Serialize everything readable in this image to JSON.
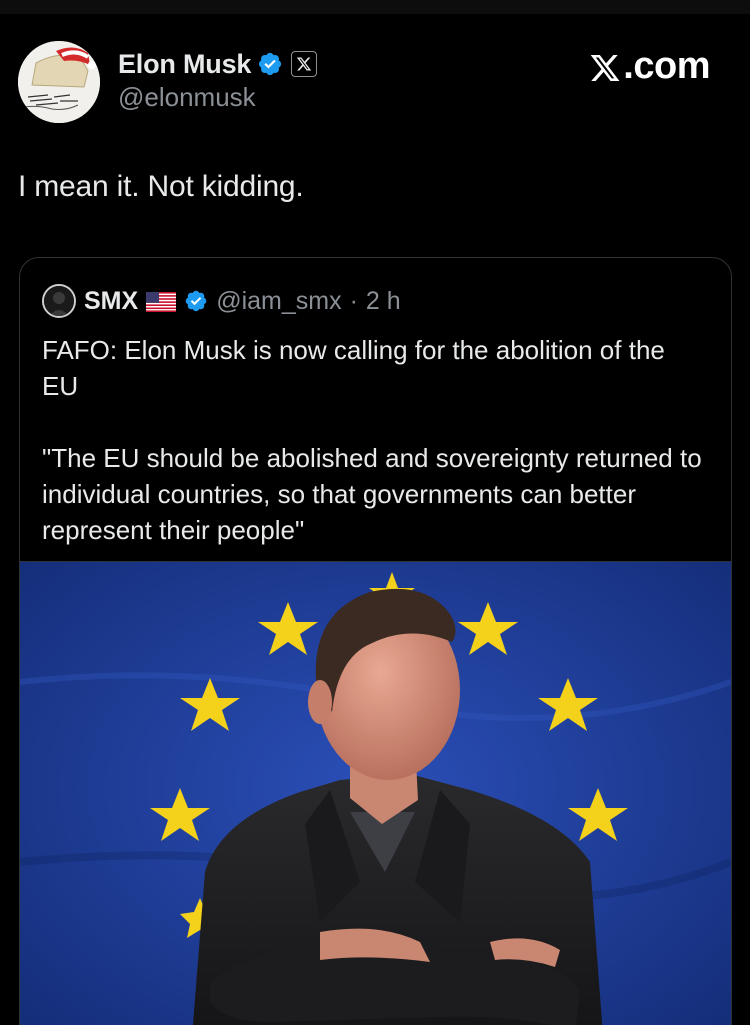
{
  "author": {
    "display_name": "Elon Musk",
    "handle": "@elonmusk",
    "avatar_icon": "santa-hat-avatar-icon",
    "verified": true,
    "badge_icon": "x-affiliate-icon"
  },
  "brand": {
    "label": ".com",
    "icon": "x-logo-icon"
  },
  "tweet": {
    "text": "I mean it. Not kidding."
  },
  "quoted_tweet": {
    "display_name": "SMX",
    "flag_icon": "us-flag-icon",
    "verified": true,
    "handle": "@iam_smx",
    "separator": "·",
    "time": "2 h",
    "paragraph_1": "FAFO: Elon Musk is now calling for the abolition of the EU",
    "paragraph_2": "\"The EU should be abolished and sovereignty returned to individual countries, so that governments can better represent their people\"",
    "media": {
      "icon": "eu-flag-portrait-image",
      "description_colors": {
        "flag_blue": "#1f3e9a",
        "star_yellow": "#f4d11a"
      }
    }
  },
  "colors": {
    "background": "#000000",
    "text_primary": "#e7e9ea",
    "text_secondary": "#8b9096",
    "verified_blue": "#1d9bf0",
    "card_border": "#2f3336"
  }
}
